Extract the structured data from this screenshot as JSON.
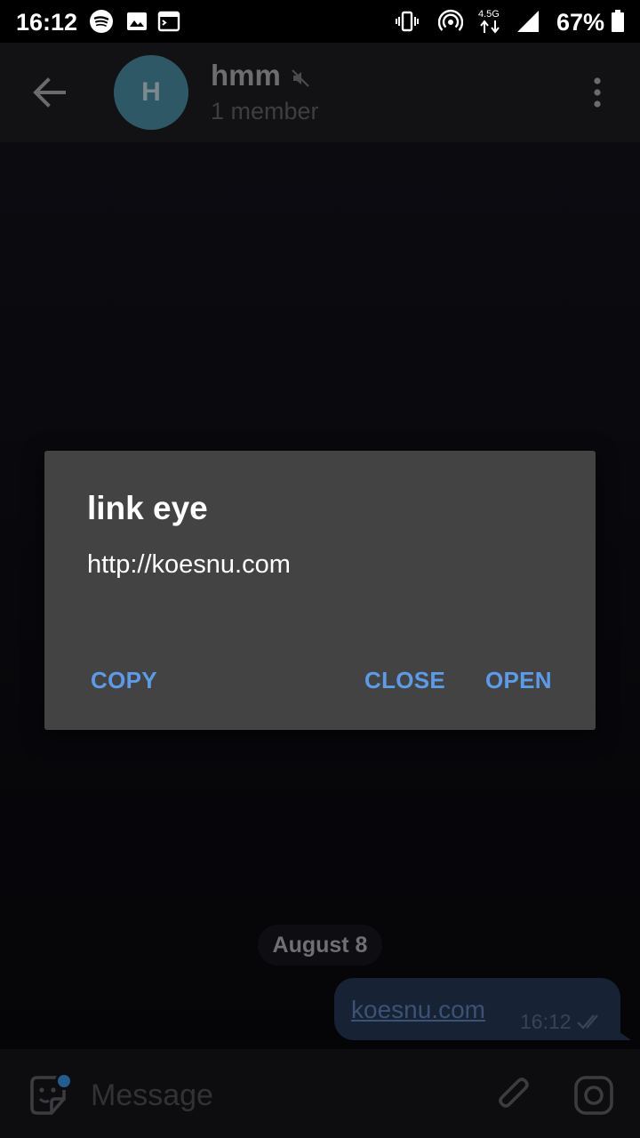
{
  "status_bar": {
    "time": "16:12",
    "network_label": "4.5G",
    "battery_percent": "67%",
    "icons": [
      "spotify-icon",
      "image-icon",
      "terminal-icon",
      "vibrate-icon",
      "hotspot-icon",
      "data-arrows-icon",
      "signal-icon",
      "battery-icon"
    ]
  },
  "header": {
    "avatar_letter": "H",
    "title": "hmm",
    "subtitle": "1 member",
    "icons": [
      "back-arrow-icon",
      "mute-icon",
      "more-vertical-icon"
    ]
  },
  "chat": {
    "date_separator": "August 8",
    "message": {
      "link_text": "koesnu.com",
      "time": "16:12",
      "status": "read"
    }
  },
  "input": {
    "placeholder": "Message",
    "icons": [
      "sticker-icon",
      "attach-icon",
      "camera-icon"
    ]
  },
  "dialog": {
    "title": "link eye",
    "url": "http://koesnu.com",
    "buttons": {
      "copy": "COPY",
      "close": "CLOSE",
      "open": "OPEN"
    }
  },
  "colors": {
    "accent": "#5c9be8",
    "dialog_bg": "#434343",
    "bubble_bg": "#172235",
    "avatar_bg": "#2f5866"
  }
}
